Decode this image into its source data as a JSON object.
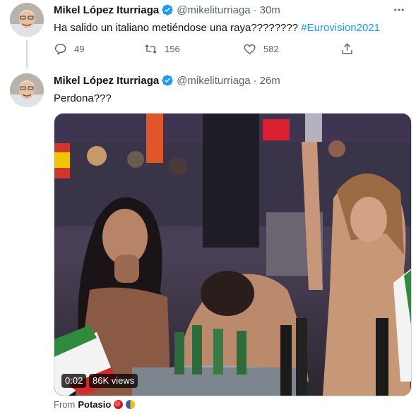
{
  "tweets": [
    {
      "author_name": "Mikel López Iturriaga",
      "handle": "@mikeliturriaga",
      "separator": "·",
      "time": "30m",
      "text_main": "Ha salido un italiano metiéndose una raya???????? ",
      "hashtag": "#Eurovision2021",
      "reply_count": "49",
      "retweet_count": "156",
      "like_count": "582"
    },
    {
      "author_name": "Mikel López Iturriaga",
      "handle": "@mikeliturriaga",
      "separator": "·",
      "time": "26m",
      "text_main": "Perdona???",
      "video": {
        "duration": "0:02",
        "views": "86K views"
      },
      "from_label": "From",
      "from_source": "Potasio"
    }
  ],
  "icons": {
    "verified": "verified-badge-icon",
    "more": "more-dots-icon",
    "reply": "reply-icon",
    "retweet": "retweet-icon",
    "like": "heart-icon",
    "share": "share-icon"
  },
  "colors": {
    "accent": "#1d9bf0",
    "text": "#0f1419",
    "muted": "#536471"
  }
}
